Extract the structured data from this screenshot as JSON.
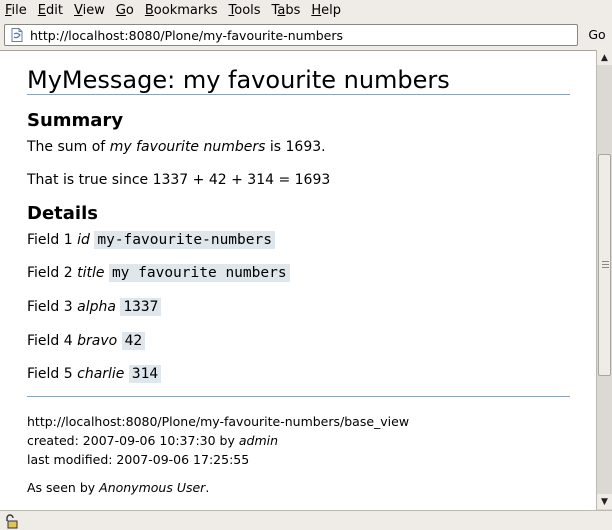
{
  "menu": [
    {
      "pre": "",
      "u": "F",
      "post": "ile"
    },
    {
      "pre": "",
      "u": "E",
      "post": "dit"
    },
    {
      "pre": "",
      "u": "V",
      "post": "iew"
    },
    {
      "pre": "",
      "u": "G",
      "post": "o"
    },
    {
      "pre": "",
      "u": "B",
      "post": "ookmarks"
    },
    {
      "pre": "",
      "u": "T",
      "post": "ools"
    },
    {
      "pre": "T",
      "u": "a",
      "post": "bs"
    },
    {
      "pre": "",
      "u": "H",
      "post": "elp"
    }
  ],
  "urlbar": {
    "url": "http://localhost:8080/Plone/my-favourite-numbers",
    "go_label": "Go"
  },
  "page": {
    "title": "MyMessage: my favourite numbers",
    "summary_heading": "Summary",
    "summary_pre": "The sum of ",
    "summary_italic": "my favourite numbers",
    "summary_post": " is 1693.",
    "summary_proof": "That is true since 1337 + 42 + 314 = 1693",
    "details_heading": "Details",
    "fields": [
      {
        "label": "Field 1 ",
        "name": "id",
        "value": "my-favourite-numbers"
      },
      {
        "label": "Field 2 ",
        "name": "title",
        "value": "my favourite numbers"
      },
      {
        "label": "Field 3 ",
        "name": "alpha",
        "value": "1337"
      },
      {
        "label": "Field 4 ",
        "name": "bravo",
        "value": "42"
      },
      {
        "label": "Field 5 ",
        "name": "charlie",
        "value": "314"
      }
    ],
    "footer": {
      "url": "http://localhost:8080/Plone/my-favourite-numbers/base_view",
      "created_pre": "created: 2007-09-06 10:37:30 by ",
      "created_by": "admin",
      "modified": "last modified: 2007-09-06 17:25:55",
      "seen_pre": "As seen by ",
      "seen_by": "Anonymous User",
      "seen_post": "."
    }
  },
  "icons": {
    "page": "page-icon",
    "lock": "lock-icon",
    "scroll_up": "arrow-up-icon",
    "scroll_down": "arrow-down-icon"
  }
}
